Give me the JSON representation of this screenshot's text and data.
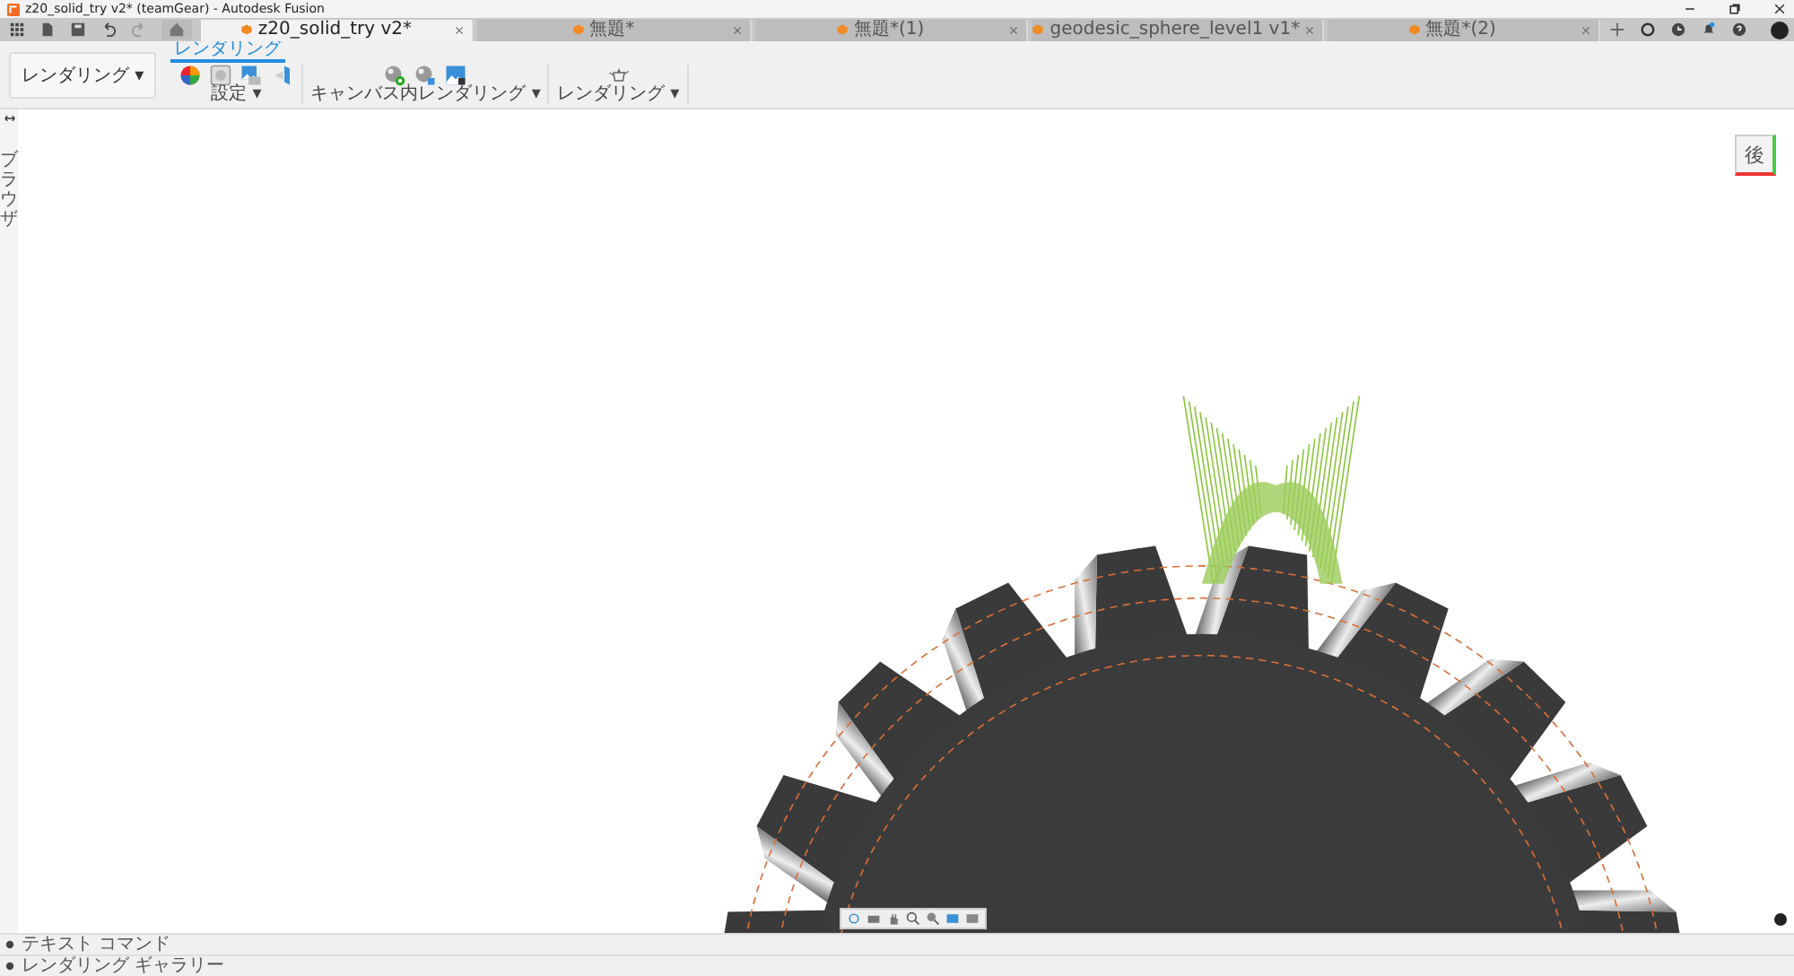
{
  "window": {
    "title": "z20_solid_try v2* (teamGear) - Autodesk Fusion"
  },
  "tabs": [
    {
      "label": "z20_solid_try v2*",
      "selected": true
    },
    {
      "label": "無題*",
      "selected": false
    },
    {
      "label": "無題*(1)",
      "selected": false
    },
    {
      "label": "geodesic_sphere_level1 v1*",
      "selected": false
    },
    {
      "label": "無題*(2)",
      "selected": false
    }
  ],
  "toolbar": {
    "workspace": "レンダリング ▾",
    "tabs": [
      {
        "label": "レンダリング",
        "selected": true
      }
    ],
    "groups": [
      {
        "label": "設定 ▾"
      },
      {
        "label": "キャンバス内レンダリング ▾"
      },
      {
        "label": "レンダリング ▾"
      }
    ]
  },
  "browser": {
    "label": "ブラウザ"
  },
  "viewcube": {
    "face": "後"
  },
  "bottom_panels": [
    {
      "label": "テキスト コマンド"
    },
    {
      "label": "レンダリング ギャラリー"
    }
  ]
}
